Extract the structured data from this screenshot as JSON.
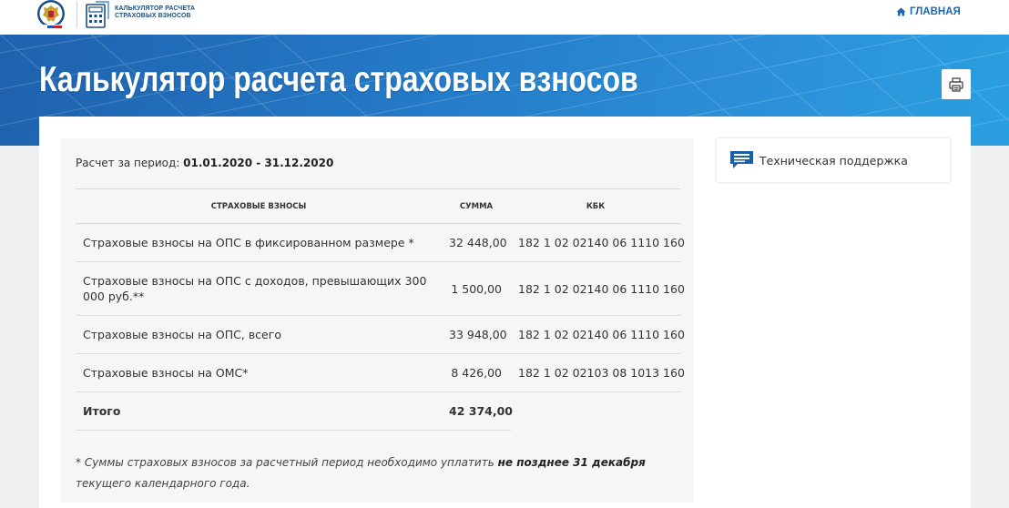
{
  "header": {
    "logo_text_line1": "КАЛЬКУЛЯТОР РАСЧЕТА",
    "logo_text_line2": "СТРАХОВЫХ ВЗНОСОВ",
    "home_label": "ГЛАВНАЯ"
  },
  "page": {
    "title": "Калькулятор расчета страховых взносов"
  },
  "calc": {
    "period_label": "Расчет за период:",
    "period_value": "01.01.2020 - 31.12.2020",
    "columns": [
      "СТРАХОВЫЕ ВЗНОСЫ",
      "СУММА",
      "КБК"
    ],
    "rows": [
      {
        "name": "Страховые взносы на ОПС в фиксированном размере *",
        "sum": "32 448,00",
        "kbk": "182 1 02 02140 06 1110 160"
      },
      {
        "name": "Страховые взносы на ОПС с доходов, превышающих 300 000 руб.**",
        "sum": "1 500,00",
        "kbk": "182 1 02 02140 06 1110 160"
      },
      {
        "name": "Страховые взносы на ОПС, всего",
        "sum": "33 948,00",
        "kbk": "182 1 02 02140 06 1110 160"
      },
      {
        "name": "Страховые взносы на ОМС*",
        "sum": "8 426,00",
        "kbk": "182 1 02 02103 08 1013 160"
      }
    ],
    "total": {
      "name": "Итого",
      "sum": "42 374,00"
    },
    "footnote_part1": "* Суммы страховых взносов за расчетный период необходимо уплатить ",
    "footnote_bold": "не позднее 31 декабря",
    "footnote_part2": " текущего календарного года."
  },
  "support": {
    "label": "Техническая поддержка"
  },
  "colors": {
    "banner_start": "#1f62ae",
    "banner_end": "#2a9fe0",
    "link": "#1a67b0"
  }
}
